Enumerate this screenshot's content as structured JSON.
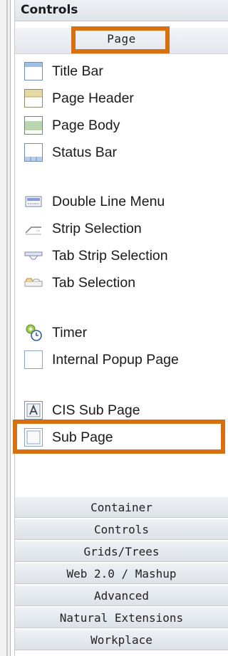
{
  "panel": {
    "title": "Controls",
    "active_section": "Page"
  },
  "items": [
    {
      "label": "Title Bar",
      "icon": "title-bar-icon"
    },
    {
      "label": "Page Header",
      "icon": "page-header-icon"
    },
    {
      "label": "Page Body",
      "icon": "page-body-icon"
    },
    {
      "label": "Status Bar",
      "icon": "status-bar-icon"
    },
    {
      "label": "Double Line Menu",
      "icon": "double-line-menu-icon"
    },
    {
      "label": "Strip Selection",
      "icon": "strip-selection-icon"
    },
    {
      "label": "Tab Strip Selection",
      "icon": "tab-strip-selection-icon"
    },
    {
      "label": "Tab Selection",
      "icon": "tab-selection-icon"
    },
    {
      "label": "Timer",
      "icon": "timer-icon"
    },
    {
      "label": "Internal Popup Page",
      "icon": "internal-popup-page-icon"
    },
    {
      "label": "CIS Sub Page",
      "icon": "cis-sub-page-icon"
    },
    {
      "label": "Sub Page",
      "icon": "sub-page-icon"
    }
  ],
  "categories": [
    "Container",
    "Controls",
    "Grids/Trees",
    "Web 2.0 / Mashup",
    "Advanced",
    "Natural Extensions",
    "Workplace"
  ],
  "colors": {
    "highlight": "#d9700f",
    "header_bg": "#e6eaef",
    "border": "#c5cad1"
  },
  "highlighted_items": [
    "Page",
    "Sub Page"
  ]
}
